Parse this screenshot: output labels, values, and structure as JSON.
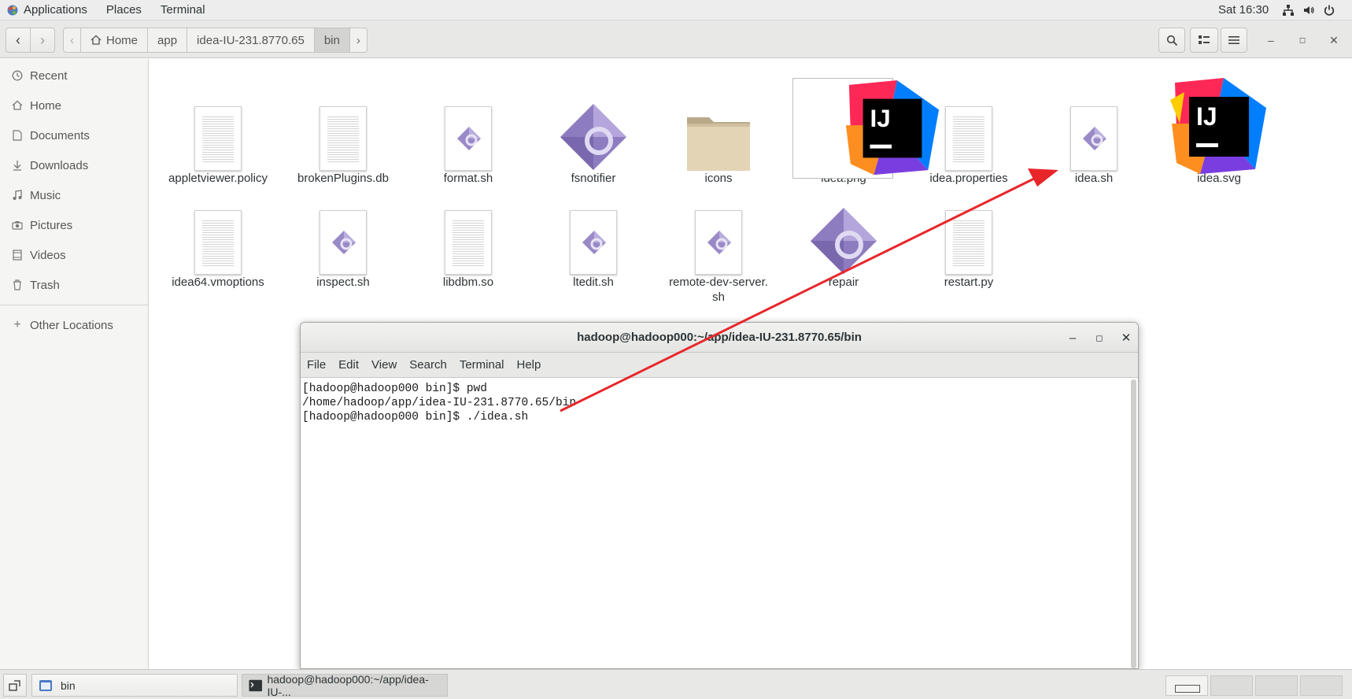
{
  "topbar": {
    "menus": [
      "Applications",
      "Places",
      "Terminal"
    ],
    "clock": "Sat 16:30",
    "tray_icons": [
      "network-icon",
      "volume-icon",
      "power-icon"
    ]
  },
  "nautilus": {
    "path": [
      "Home",
      "app",
      "idea-IU-231.8770.65",
      "bin"
    ],
    "sidebar": [
      {
        "label": "Recent",
        "icon": "clock-icon"
      },
      {
        "label": "Home",
        "icon": "home-icon"
      },
      {
        "label": "Documents",
        "icon": "document-icon"
      },
      {
        "label": "Downloads",
        "icon": "download-icon"
      },
      {
        "label": "Music",
        "icon": "music-icon"
      },
      {
        "label": "Pictures",
        "icon": "camera-icon"
      },
      {
        "label": "Videos",
        "icon": "video-icon"
      },
      {
        "label": "Trash",
        "icon": "trash-icon"
      }
    ],
    "other_locations": "Other Locations",
    "files": [
      {
        "name": "appletviewer.policy",
        "type": "text"
      },
      {
        "name": "brokenPlugins.db",
        "type": "text"
      },
      {
        "name": "format.sh",
        "type": "script"
      },
      {
        "name": "fsnotifier",
        "type": "executable"
      },
      {
        "name": "icons",
        "type": "folder"
      },
      {
        "name": "idea.png",
        "type": "image-selected"
      },
      {
        "name": "idea.properties",
        "type": "text"
      },
      {
        "name": "idea.sh",
        "type": "script"
      },
      {
        "name": "idea.svg",
        "type": "image"
      },
      {
        "name": "idea64.vmoptions",
        "type": "text"
      },
      {
        "name": "inspect.sh",
        "type": "script"
      },
      {
        "name": "libdbm.so",
        "type": "text"
      },
      {
        "name": "ltedit.sh",
        "type": "script"
      },
      {
        "name": "remote-dev-server.",
        "name2": "sh",
        "type": "script"
      },
      {
        "name": "repair",
        "type": "executable"
      },
      {
        "name": "restart.py",
        "type": "text"
      }
    ]
  },
  "terminal": {
    "title": "hadoop@hadoop000:~/app/idea-IU-231.8770.65/bin",
    "menu": [
      "File",
      "Edit",
      "View",
      "Search",
      "Terminal",
      "Help"
    ],
    "lines": [
      "[hadoop@hadoop000 bin]$ pwd",
      "/home/hadoop/app/idea-IU-231.8770.65/bin",
      "[hadoop@hadoop000 bin]$ ./idea.sh"
    ]
  },
  "taskbar": {
    "tasks": [
      "bin",
      "hadoop@hadoop000:~/app/idea-IU-..."
    ]
  },
  "colors": {
    "arrow": "#e8262a",
    "accent": "#4a90d9"
  }
}
